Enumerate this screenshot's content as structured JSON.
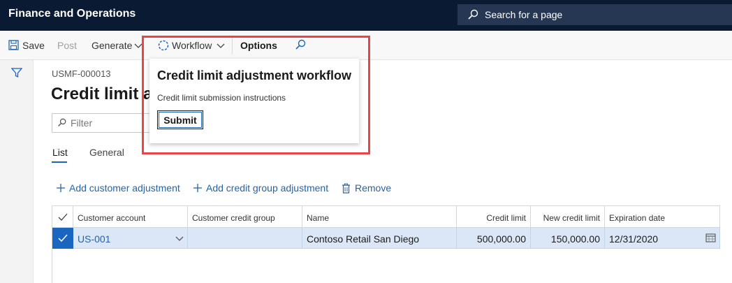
{
  "app": {
    "title": "Finance and Operations"
  },
  "search": {
    "label": "Search for a page"
  },
  "actionpane": {
    "save": "Save",
    "post": "Post",
    "generate": "Generate",
    "workflow": "Workflow",
    "options": "Options"
  },
  "record": {
    "id": "USMF-000013",
    "title": "Credit limit adjustment"
  },
  "filter": {
    "placeholder": "Filter"
  },
  "tabs": [
    {
      "label": "List"
    },
    {
      "label": "General"
    }
  ],
  "grid_actions": {
    "add_customer": "Add customer adjustment",
    "add_group": "Add credit group adjustment",
    "remove": "Remove"
  },
  "grid": {
    "columns": [
      "Customer account",
      "Customer credit group",
      "Name",
      "Credit limit",
      "New credit limit",
      "Expiration date"
    ],
    "rows": [
      {
        "customer_account": "US-001",
        "customer_credit_group": "",
        "name": "Contoso Retail San Diego",
        "credit_limit": "500,000.00",
        "new_credit_limit": "150,000.00",
        "expiration_date": "12/31/2020"
      }
    ]
  },
  "flyout": {
    "title": "Credit limit adjustment workflow",
    "instructions": "Credit limit submission instructions",
    "submit": "Submit"
  },
  "colors": {
    "navbar": "#0b1a33",
    "accent": "#1a65c0",
    "link": "#2563a8",
    "highlight": "#e84646",
    "row_selected": "#dbe6f7"
  }
}
